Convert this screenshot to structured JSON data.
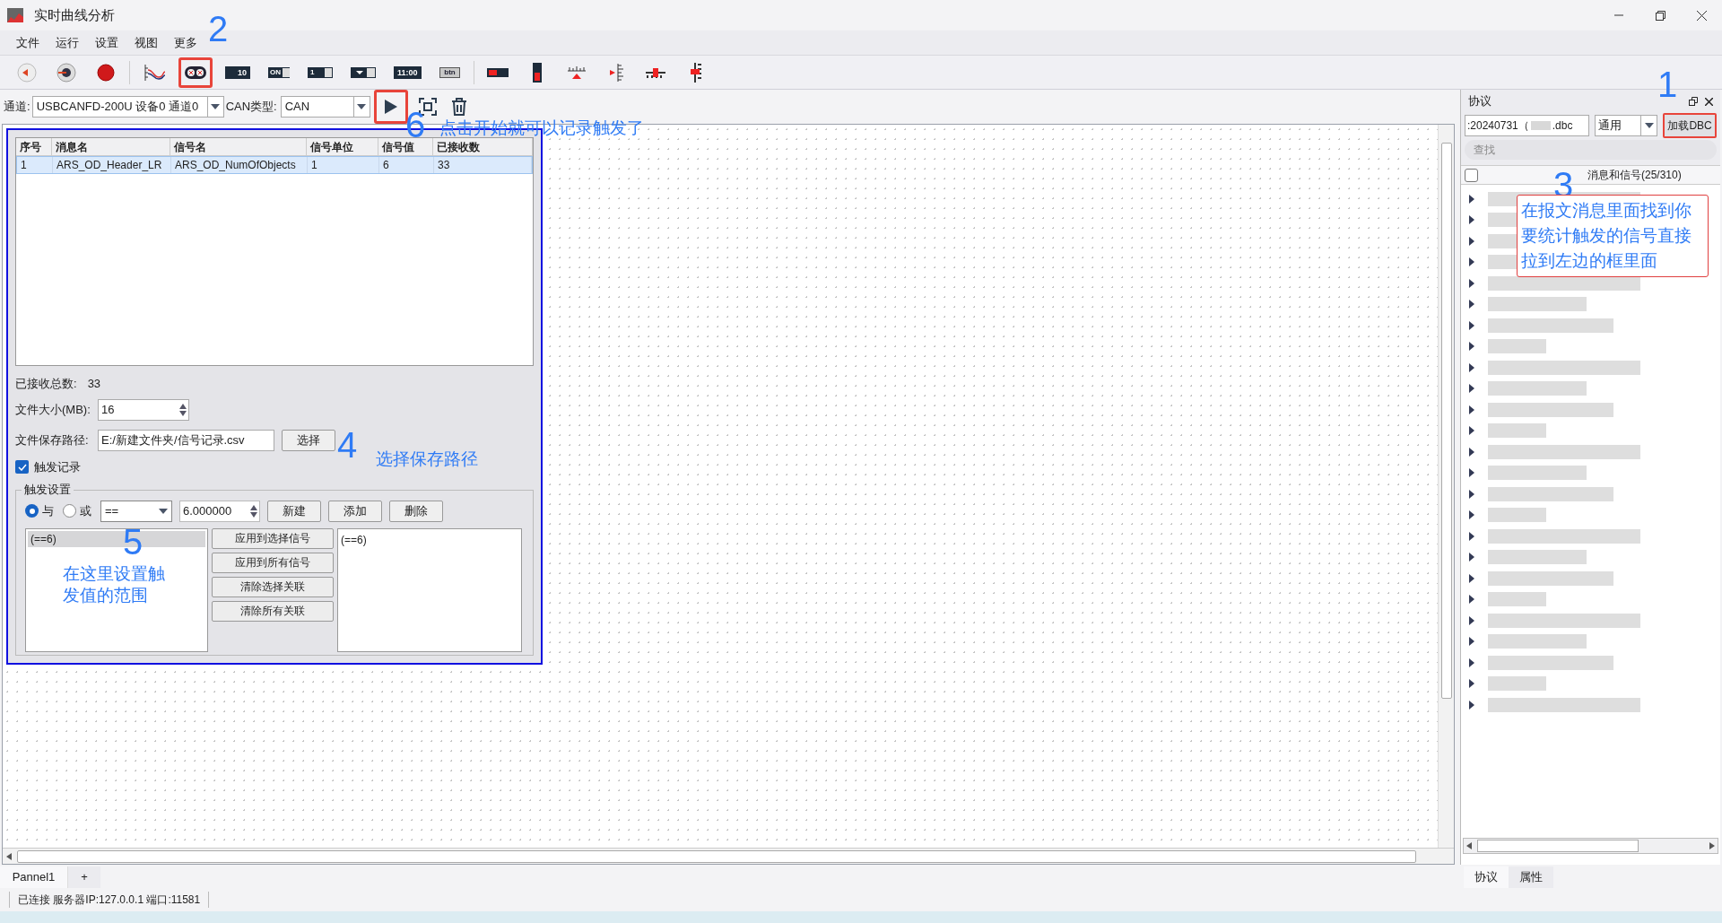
{
  "window": {
    "title": "实时曲线分析"
  },
  "menu": [
    "文件",
    "运行",
    "设置",
    "视图",
    "更多"
  ],
  "toolbar": [
    {
      "kind": "back",
      "highlighted": false
    },
    {
      "kind": "stop",
      "highlighted": false
    },
    {
      "kind": "record",
      "highlighted": false
    },
    {
      "kind": "sep"
    },
    {
      "kind": "curve",
      "highlighted": false
    },
    {
      "kind": "switch",
      "highlighted": true
    },
    {
      "kind": "display",
      "label": "10",
      "highlighted": false
    },
    {
      "kind": "toggle",
      "label": "ON",
      "highlighted": false
    },
    {
      "kind": "spin",
      "label": "1",
      "highlighted": false
    },
    {
      "kind": "combo",
      "highlighted": false
    },
    {
      "kind": "display",
      "label": "11:00",
      "highlighted": false
    },
    {
      "kind": "btn",
      "label": "btn",
      "highlighted": false
    },
    {
      "kind": "sep"
    },
    {
      "kind": "hbar",
      "highlighted": false
    },
    {
      "kind": "vbar",
      "highlighted": false
    },
    {
      "kind": "ruler",
      "highlighted": false
    },
    {
      "kind": "vscale",
      "highlighted": false
    },
    {
      "kind": "hslider",
      "highlighted": false
    },
    {
      "kind": "vslider",
      "highlighted": false
    }
  ],
  "channel_bar": {
    "channel_label": "通道:",
    "channel": "USBCANFD-200U 设备0 通道0",
    "can_type_label": "CAN类型:",
    "can_type": "CAN",
    "start_highlighted": true
  },
  "dialog": {
    "table": {
      "columns": [
        "序号",
        "消息名",
        "信号名",
        "信号单位",
        "信号值",
        "已接收数"
      ],
      "rows": [
        {
          "cells": [
            "1",
            "ARS_OD_Header_LR",
            "ARS_OD_NumOfObjects",
            "1",
            "6",
            "33"
          ],
          "selected": true
        }
      ]
    },
    "total_label": "已接收总数:",
    "total": "33",
    "file_size_label": "文件大小(MB):",
    "file_size": "16",
    "path_label": "文件保存路径:",
    "path": "E:/新建文件夹/信号记录.csv",
    "choose_button": "选择",
    "trigger_record": {
      "label": "触发记录",
      "checked": true
    },
    "trigger_settings": {
      "title": "触发设置",
      "radios": [
        {
          "label": "与",
          "selected": true
        },
        {
          "label": "或",
          "selected": false
        }
      ],
      "operator": "==",
      "value": "6.000000",
      "buttons": [
        "新建",
        "添加",
        "删除"
      ],
      "conditions": [
        {
          "text": "(==6)",
          "selected": true
        }
      ],
      "apply_buttons": [
        "应用到选择信号",
        "应用到所有信号",
        "清除选择关联",
        "清除所有关联"
      ],
      "linked": [
        "(==6)"
      ]
    }
  },
  "protocol_panel": {
    "title": "协议",
    "dbc_file": ":20240731（",
    "dbc_suffix": ".dbc",
    "mode": "通用",
    "load_button": "加载DBC",
    "load_highlighted": true,
    "search": {
      "placeholder": "查找"
    },
    "select_all_checked": false,
    "tree_header": "消息和信号(25/310)",
    "tree_items": [
      {
        "expanded": false
      },
      {
        "expanded": false
      },
      {
        "expanded": false
      },
      {
        "expanded": false
      },
      {
        "expanded": false
      },
      {
        "expanded": false
      },
      {
        "expanded": false
      },
      {
        "expanded": false
      },
      {
        "expanded": false
      },
      {
        "expanded": false
      },
      {
        "expanded": false
      },
      {
        "expanded": false
      },
      {
        "expanded": false
      },
      {
        "expanded": false
      },
      {
        "expanded": false
      },
      {
        "expanded": false
      },
      {
        "expanded": false
      },
      {
        "expanded": false
      },
      {
        "expanded": false
      },
      {
        "expanded": false
      },
      {
        "expanded": false
      },
      {
        "expanded": false
      },
      {
        "expanded": false
      },
      {
        "expanded": false
      },
      {
        "expanded": false
      }
    ],
    "tabs": [
      {
        "label": "协议",
        "selected": true
      },
      {
        "label": "属性",
        "selected": false
      }
    ]
  },
  "panel_tabs": [
    {
      "label": "Pannel1",
      "selected": true
    },
    {
      "label": "+",
      "selected": false
    }
  ],
  "status_bar": "已连接 服务器IP:127.0.0.1 端口:11581",
  "annotations": [
    {
      "kind": "number",
      "text": "1"
    },
    {
      "kind": "number",
      "text": "2"
    },
    {
      "kind": "number",
      "text": "3"
    },
    {
      "kind": "boxed_note",
      "text": "在报文消息里面找到你要统计触发的信号直接拉到左边的框里面"
    },
    {
      "kind": "number",
      "text": "4"
    },
    {
      "kind": "note",
      "text": "选择保存路径"
    },
    {
      "kind": "number",
      "text": "5"
    },
    {
      "kind": "note",
      "text": "在这里设置触发值的范围"
    },
    {
      "kind": "number",
      "text": "6"
    },
    {
      "kind": "note",
      "text": "点击开始就可以记录触发了"
    }
  ]
}
